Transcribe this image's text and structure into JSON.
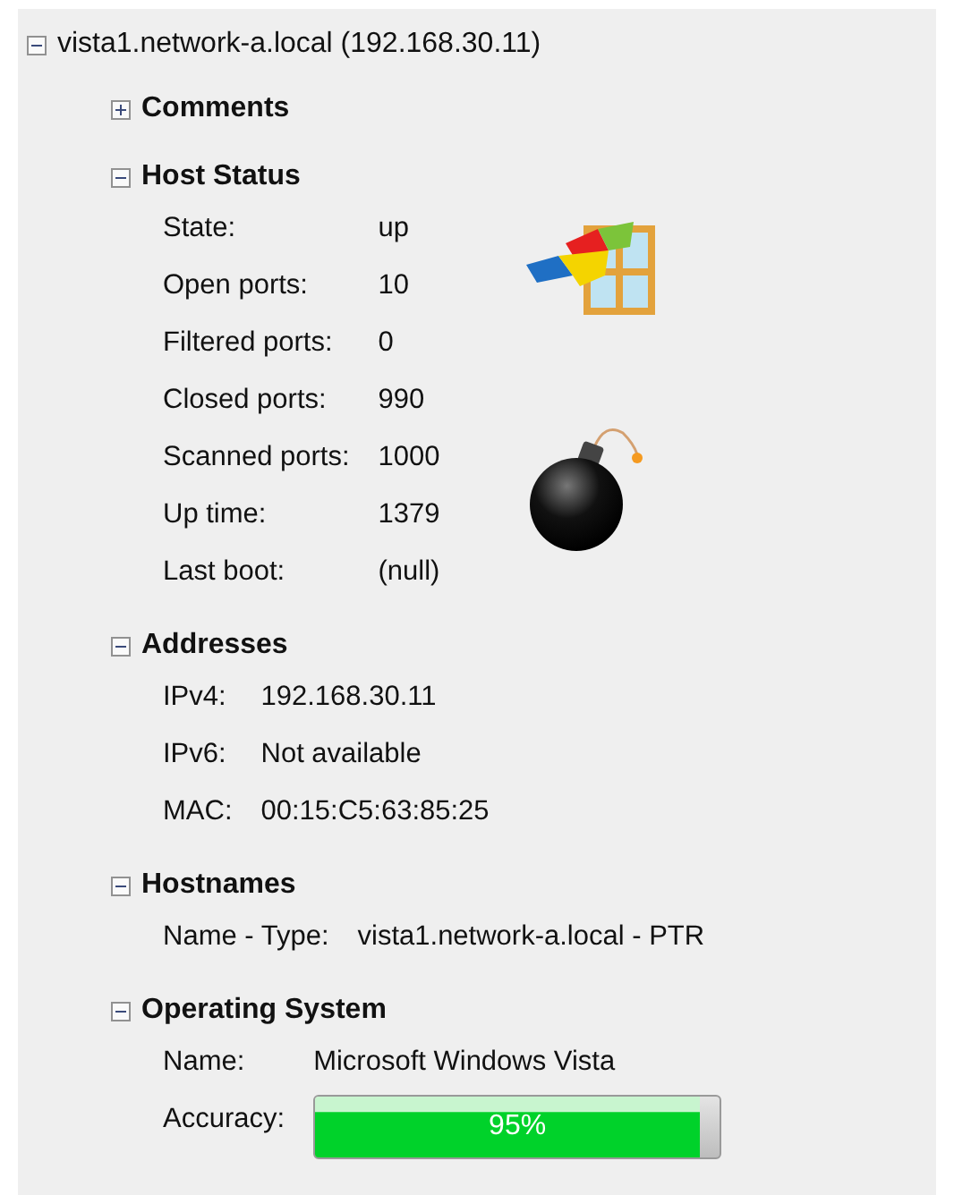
{
  "root": {
    "label": "vista1.network-a.local (192.168.30.11)",
    "expanded": true
  },
  "sections": [
    {
      "title": "Comments",
      "expanded": false
    },
    {
      "title": "Host Status",
      "kind": "host_status",
      "expanded": true,
      "fields": [
        {
          "kind": "text",
          "label": "State:",
          "value": "up"
        },
        {
          "kind": "text",
          "label": "Open ports:",
          "value": "10"
        },
        {
          "kind": "text",
          "label": "Filtered ports:",
          "value": "0"
        },
        {
          "kind": "text",
          "label": "Closed ports:",
          "value": "990"
        },
        {
          "kind": "text",
          "label": "Scanned ports:",
          "value": "1000"
        },
        {
          "kind": "text",
          "label": "Up time:",
          "value": "1379"
        },
        {
          "kind": "text",
          "label": "Last boot:",
          "value": "(null)"
        }
      ]
    },
    {
      "title": "Addresses",
      "kind": "plain",
      "expanded": true,
      "fields": [
        {
          "kind": "text",
          "label": "IPv4:",
          "value": "192.168.30.11"
        },
        {
          "kind": "text",
          "label": "IPv6:",
          "value": "Not available"
        },
        {
          "kind": "text",
          "label": "MAC:",
          "value": "00:15:C5:63:85:25"
        }
      ]
    },
    {
      "title": "Hostnames",
      "kind": "plain",
      "expanded": true,
      "fields": [
        {
          "kind": "text",
          "label": "Name - Type:",
          "value": "vista1.network-a.local - PTR"
        }
      ]
    },
    {
      "title": "Operating System",
      "kind": "plain",
      "expanded": true,
      "fields": [
        {
          "kind": "text",
          "label": "Name:",
          "value": "Microsoft Windows Vista"
        },
        {
          "kind": "meter",
          "label": "Accuracy:",
          "value": "95%",
          "level": 0.95
        }
      ]
    }
  ]
}
